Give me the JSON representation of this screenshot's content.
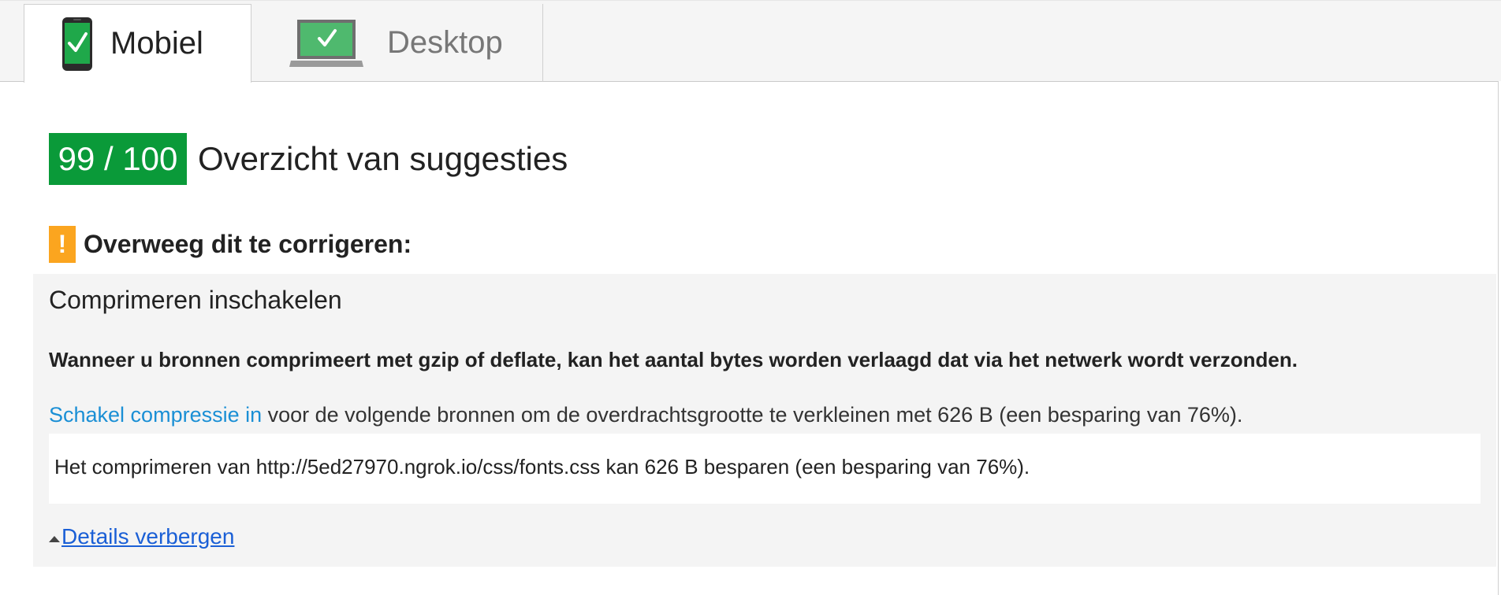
{
  "tabs": [
    {
      "label": "Mobiel",
      "icon": "mobile-phone-check-icon",
      "active": true
    },
    {
      "label": "Desktop",
      "icon": "laptop-check-icon",
      "active": false
    }
  ],
  "score": {
    "value": "99 / 100",
    "title": "Overzicht van suggesties",
    "color": "#0a9a39"
  },
  "warning": {
    "title": "Overweeg dit te corrigeren:",
    "icon": "exclamation-warning-icon",
    "icon_text": "!",
    "color": "#fba51f"
  },
  "rule": {
    "title": "Comprimeren inschakelen",
    "summary": "Wanneer u bronnen comprimeert met gzip of deflate, kan het aantal bytes worden verlaagd dat via het netwerk wordt verzonden.",
    "link_text": "Schakel compressie in",
    "description": " voor de volgende bronnen om de overdrachtsgrootte te verkleinen met 626 B (een besparing van 76%).",
    "details": [
      "Het comprimeren van http://5ed27970.ngrok.io/css/fonts.css kan 626 B besparen (een besparing van 76%)."
    ],
    "toggle_label": "Details verbergen"
  },
  "colors": {
    "link": "#1a8fd5",
    "toggle_link": "#1a5fd6"
  }
}
